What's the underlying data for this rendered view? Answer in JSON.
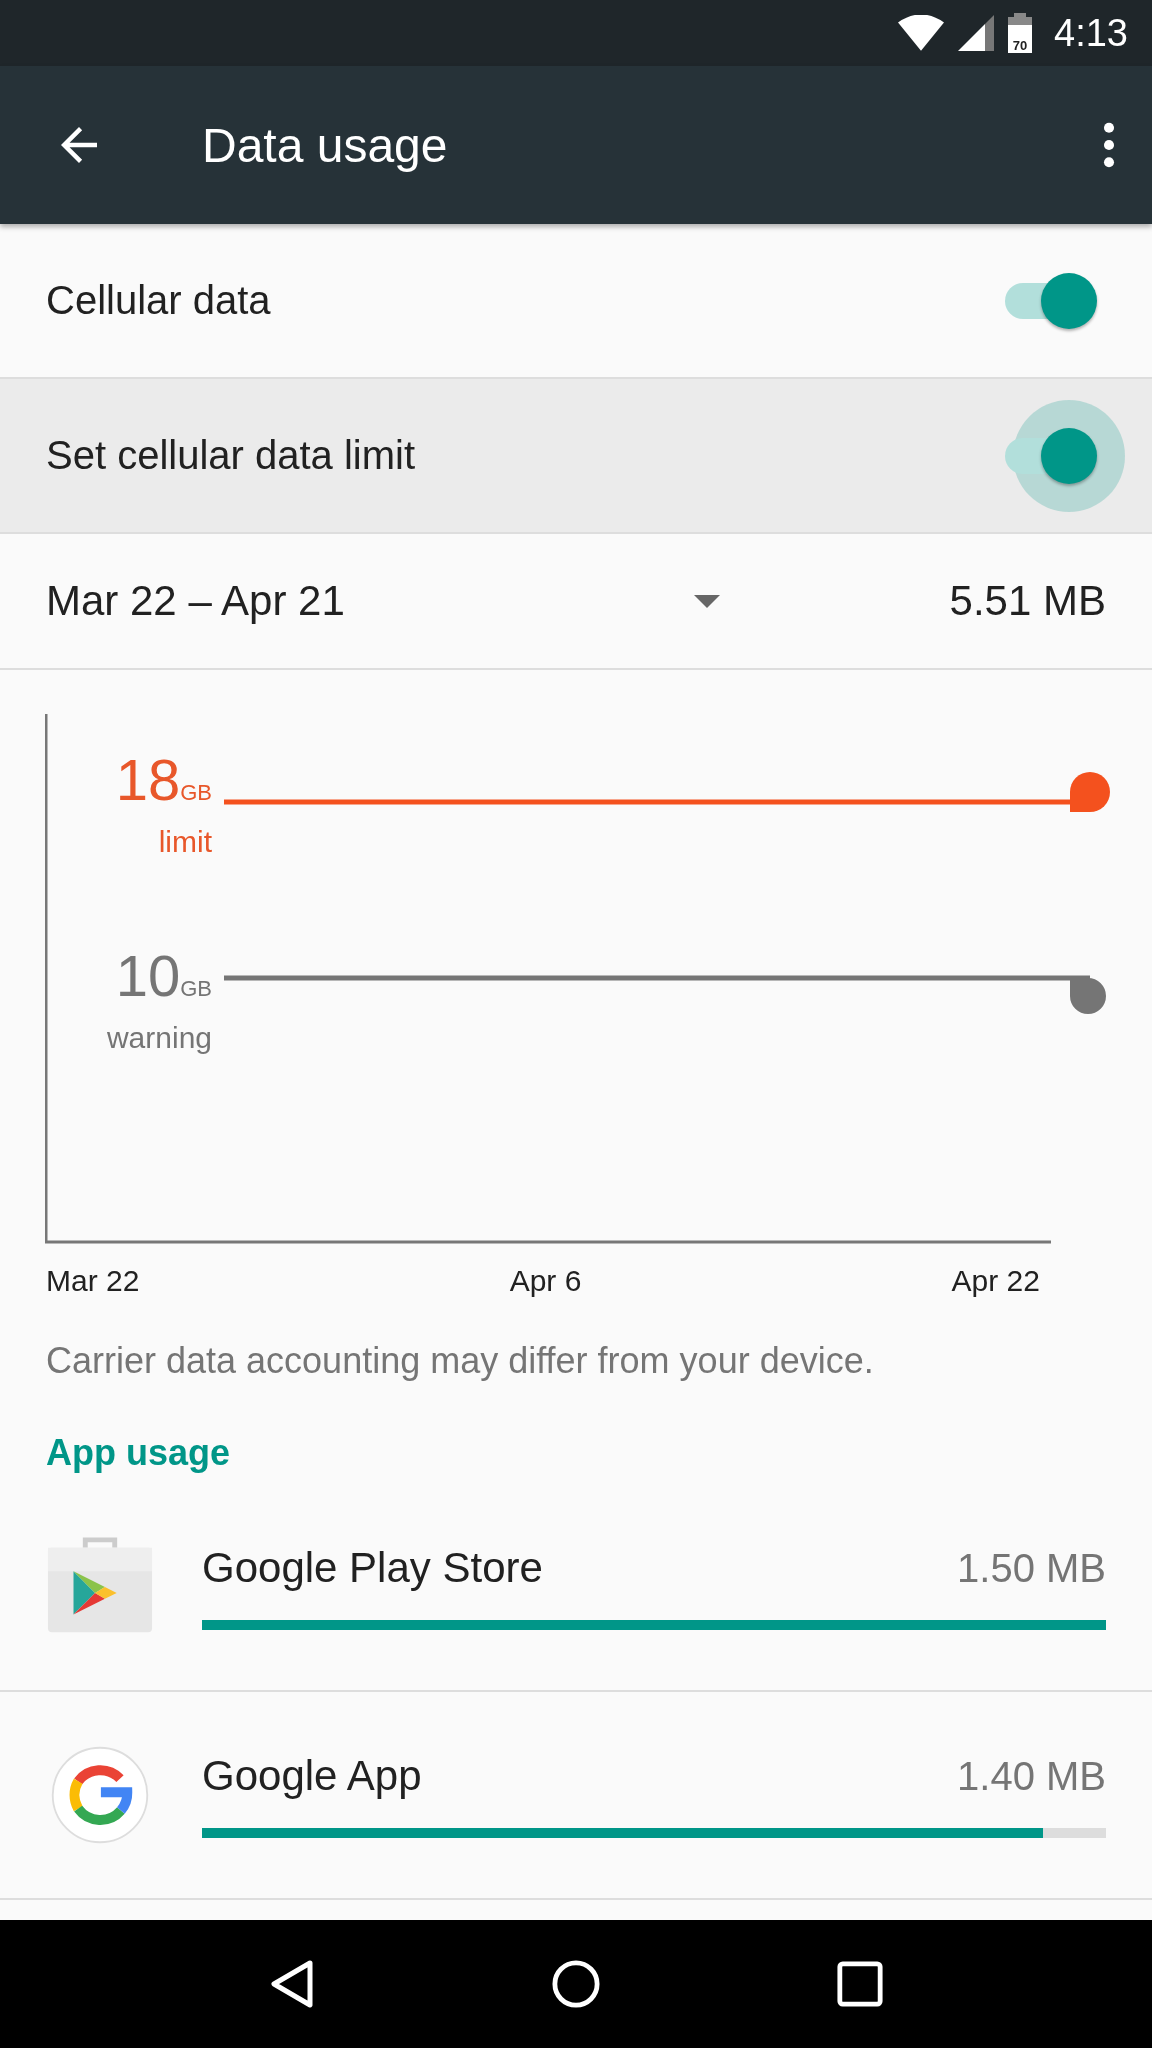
{
  "status_bar": {
    "battery": "70",
    "time": "4:13"
  },
  "toolbar": {
    "title": "Data usage"
  },
  "settings": [
    {
      "label": "Cellular data",
      "on": true,
      "pressed": false
    },
    {
      "label": "Set cellular data limit",
      "on": true,
      "pressed": true
    }
  ],
  "cycle": {
    "range": "Mar 22 – Apr 21",
    "total": "5.51 MB"
  },
  "chart": {
    "thresholds": [
      {
        "kind": "limit",
        "value": "18",
        "unit": "GB",
        "label": "limit"
      },
      {
        "kind": "warning",
        "value": "10",
        "unit": "GB",
        "label": "warning"
      }
    ],
    "x_labels": [
      "Mar 22",
      "Apr 6",
      "Apr 22"
    ]
  },
  "note": "Carrier data accounting may differ from your device.",
  "app_usage": {
    "heading": "App usage",
    "apps": [
      {
        "kind": "store",
        "name": "Google Play Store",
        "amount": "1.50 MB",
        "level": 1.0
      },
      {
        "kind": "google",
        "name": "Google App",
        "amount": "1.40 MB",
        "level": 0.93
      }
    ]
  }
}
